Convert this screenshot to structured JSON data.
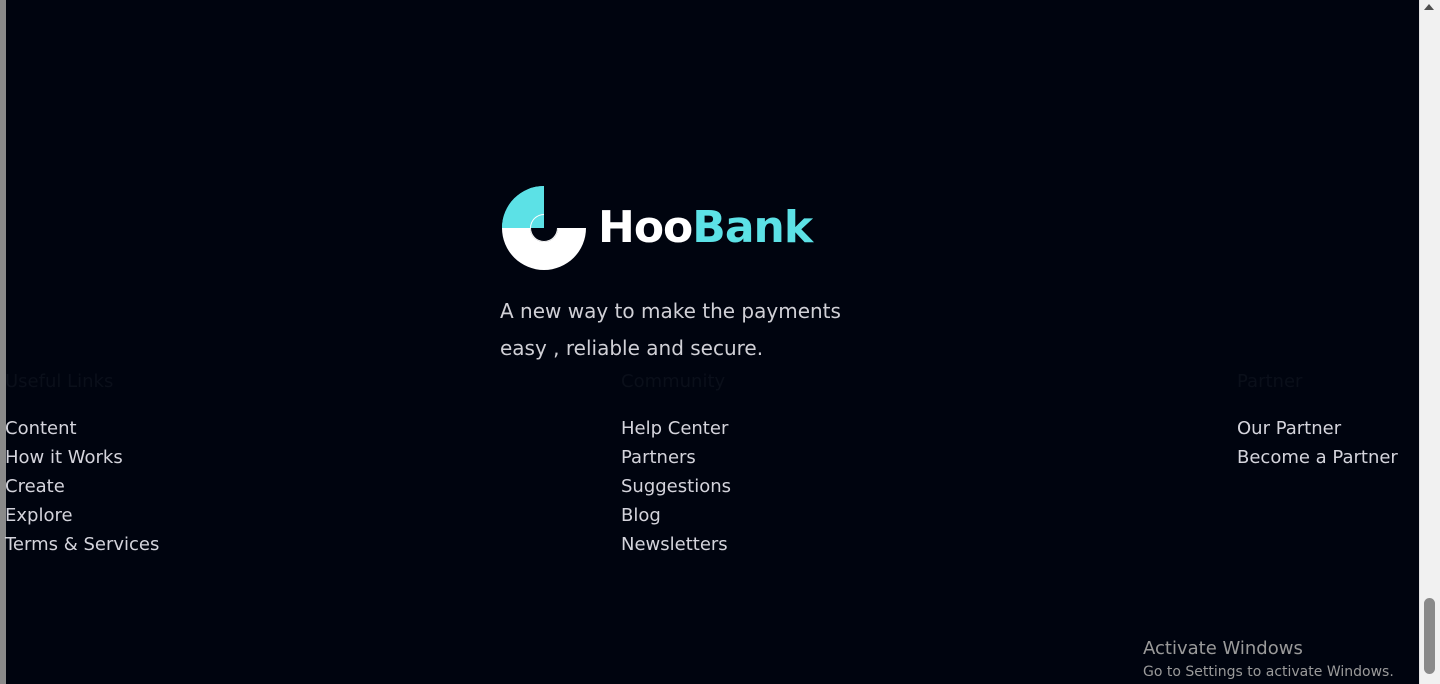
{
  "brand": {
    "name_part1": "Hoo",
    "name_part2": "Bank",
    "accent_color": "#5ce1e6",
    "icon": "hoobank-logo-icon"
  },
  "tagline": {
    "line1": "A new way to make the payments",
    "line2": "easy , reliable and secure."
  },
  "footer": {
    "columns": [
      {
        "title": "Useful Links",
        "links": [
          "Content",
          "How it Works",
          "Create",
          "Explore",
          "Terms & Services"
        ]
      },
      {
        "title": "Community",
        "links": [
          "Help Center",
          "Partners",
          "Suggestions",
          "Blog",
          "Newsletters"
        ]
      },
      {
        "title": "Partner",
        "links": [
          "Our Partner",
          "Become a Partner"
        ]
      }
    ]
  },
  "watermark": {
    "title": "Activate Windows",
    "subtitle": "Go to Settings to activate Windows."
  },
  "colors": {
    "background": "#00040f",
    "link_text": "#d4d4dc"
  }
}
